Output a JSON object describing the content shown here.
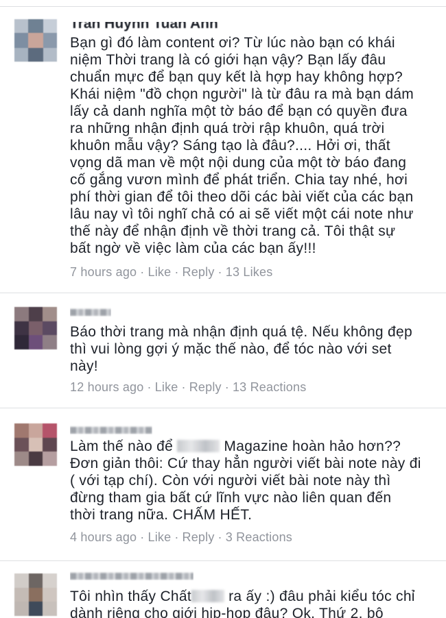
{
  "comments": [
    {
      "author": "Trần Huỳnh Tuấn Anh",
      "text": "Bạn gì đó làm content ơi? Từ lúc nào bạn có khái\nniệm Thời trang là có giới hạn vậy? Bạn lấy đâu\nchuẩn mực để bạn quy kết là hợp hay không hợp?\nKhái niệm \"đồ chọn người\" là từ đâu ra mà bạn dám\nlấy cả danh nghĩa một tờ báo để bạn có quyền đưa\nra những nhận định quá trời rập khuôn, quá trời\nkhuôn mẫu vậy? Sáng tạo là đâu?.... Hởi ơi, thất\nvọng dã man về một nội dung của một tờ báo đang\ncố gắng vươn mình để phát triển. Chia tay nhé, hơi\nphí thời gian để tôi theo dõi các bài viết của các bạn\nlâu nay vì tôi nghĩ chả có ai sẽ viết một cái note như\nthế này để nhận định về thời trang cả. Tôi thật sự\nbất ngờ về việc làm của các bạn ấy!!!",
      "time": "7 hours ago",
      "like": "Like",
      "reply": "Reply",
      "reactions": "13 Likes"
    },
    {
      "author": "",
      "text": "Báo thời trang mà nhận định quá tệ. Nếu không đẹp\nthì vui lòng gợi ý mặc thế nào, để tóc nào với set\nnày!",
      "time": "12 hours ago",
      "like": "Like",
      "reply": "Reply",
      "reactions": "13 Reactions"
    },
    {
      "author": "",
      "text_a": "Làm thế nào để ",
      "text_b": " Magazine hoàn hảo hơn??\nĐơn giản thôi: Cứ thay hẳn người viết bài note này đi\n( với tạp chí). Còn với người viết bài note này thì\nđừng tham gia bất cứ lĩnh vực nào liên quan đến\nthời trang nữa. CHẤM HẾT.",
      "time": "4 hours ago",
      "like": "Like",
      "reply": "Reply",
      "reactions": "3 Reactions"
    },
    {
      "author": "",
      "text_a": "Tôi nhìn thấy Chất",
      "text_b": " ra ấy :) đâu phải kiểu tóc chỉ\ndành riêng cho giới hip-hop đâu? Ok. Thứ 2, bộ"
    }
  ],
  "separator": "·"
}
